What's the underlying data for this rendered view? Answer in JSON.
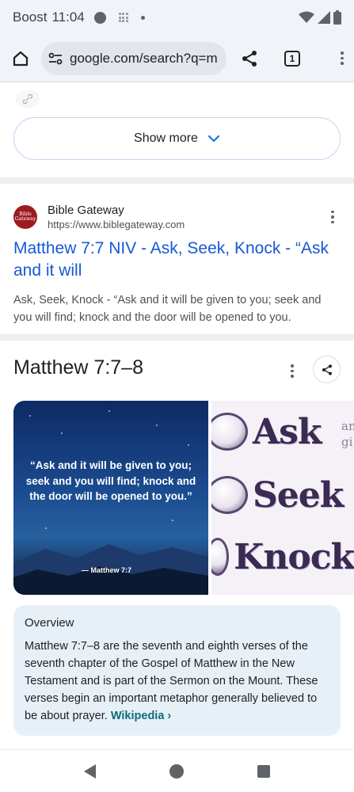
{
  "status_bar": {
    "carrier": "Boost",
    "time": "11:04"
  },
  "browser": {
    "url": "google.com/search?q=m",
    "tab_count": "1"
  },
  "results": {
    "show_more_label": "Show more",
    "result": {
      "site_name": "Bible Gateway",
      "site_url": "https://www.biblegateway.com",
      "favicon_text": "Bible Gateway",
      "title": "Matthew 7:7 NIV - Ask, Seek, Knock - “Ask and it will",
      "snippet": "Ask, Seek, Knock - “Ask and it will be given to you; seek and you will find; knock and the door will be opened to you."
    }
  },
  "knowledge_panel": {
    "title": "Matthew 7:7–8",
    "image_left": {
      "quote": "“Ask and it will be given to you; seek and you will find; knock and the door will be opened to you.”",
      "attribution": "— Matthew 7:7"
    },
    "image_right": {
      "words": [
        "Ask",
        "Seek",
        "Knock"
      ],
      "side_text": "an gi"
    },
    "overview": {
      "heading": "Overview",
      "text": "Matthew 7:7–8 are the seventh and eighth verses of the seventh chapter of the Gospel of Matthew in the New Testament and is part of the Sermon on the Mount. These verses begin an important metaphor generally believed to be about prayer.",
      "source_link": "Wikipedia ›"
    }
  },
  "colors": {
    "link_blue": "#1558d6",
    "overview_bg": "#e8f0f7",
    "wiki_teal": "#0b6e7a",
    "favicon_red": "#9d1b1e"
  }
}
